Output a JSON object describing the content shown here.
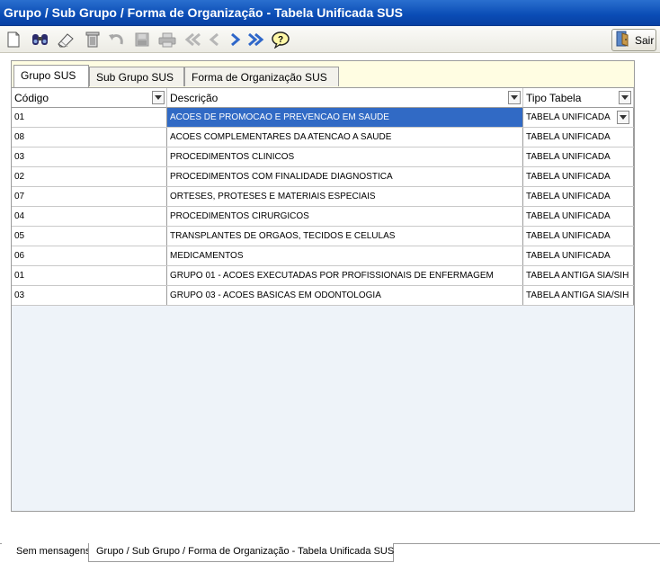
{
  "window": {
    "title": "Grupo / Sub Grupo  / Forma de Organização - Tabela Unificada SUS"
  },
  "toolbar": {
    "icons": [
      "new-icon",
      "search-icon",
      "edit-icon",
      "delete-icon",
      "undo-icon",
      "save-icon",
      "print-icon",
      "first-icon",
      "previous-icon",
      "next-icon",
      "last-icon",
      "help-icon"
    ],
    "exit_label": "Sair"
  },
  "tabs": [
    {
      "label": "Grupo SUS",
      "active": true
    },
    {
      "label": "Sub Grupo SUS",
      "active": false
    },
    {
      "label": "Forma de Organização SUS",
      "active": false
    }
  ],
  "grid": {
    "columns": [
      "Código",
      "Descrição",
      "Tipo Tabela"
    ],
    "rows": [
      {
        "codigo": "01",
        "descricao": "ACOES DE PROMOCAO E PREVENCAO EM SAUDE",
        "tipo": "TABELA UNIFICADA"
      },
      {
        "codigo": "08",
        "descricao": "ACOES COMPLEMENTARES DA ATENCAO A SAUDE",
        "tipo": "TABELA UNIFICADA"
      },
      {
        "codigo": "03",
        "descricao": "PROCEDIMENTOS CLINICOS",
        "tipo": "TABELA UNIFICADA"
      },
      {
        "codigo": "02",
        "descricao": "PROCEDIMENTOS COM FINALIDADE DIAGNOSTICA",
        "tipo": "TABELA UNIFICADA"
      },
      {
        "codigo": "07",
        "descricao": "ORTESES, PROTESES E MATERIAIS ESPECIAIS",
        "tipo": "TABELA UNIFICADA"
      },
      {
        "codigo": "04",
        "descricao": "PROCEDIMENTOS CIRURGICOS",
        "tipo": "TABELA UNIFICADA"
      },
      {
        "codigo": "05",
        "descricao": "TRANSPLANTES DE ORGAOS, TECIDOS E CELULAS",
        "tipo": "TABELA UNIFICADA"
      },
      {
        "codigo": "06",
        "descricao": "MEDICAMENTOS",
        "tipo": "TABELA UNIFICADA"
      },
      {
        "codigo": "01",
        "descricao": "GRUPO 01 - ACOES EXECUTADAS POR PROFISSIONAIS DE ENFERMAGEM",
        "tipo": "TABELA ANTIGA SIA/SIH"
      },
      {
        "codigo": "03",
        "descricao": "GRUPO 03 - ACOES BASICAS EM ODONTOLOGIA",
        "tipo": "TABELA ANTIGA SIA/SIH"
      }
    ]
  },
  "status": {
    "tab1": "Sem mensagens",
    "tab2": "Grupo / Sub Grupo  / Forma de Organização - Tabela Unificada SUS"
  },
  "colors": {
    "titlebar": "#0a4cb5",
    "selection": "#316ac5",
    "panel_bg": "#fffde2",
    "grid_bg": "#eef3f9"
  }
}
